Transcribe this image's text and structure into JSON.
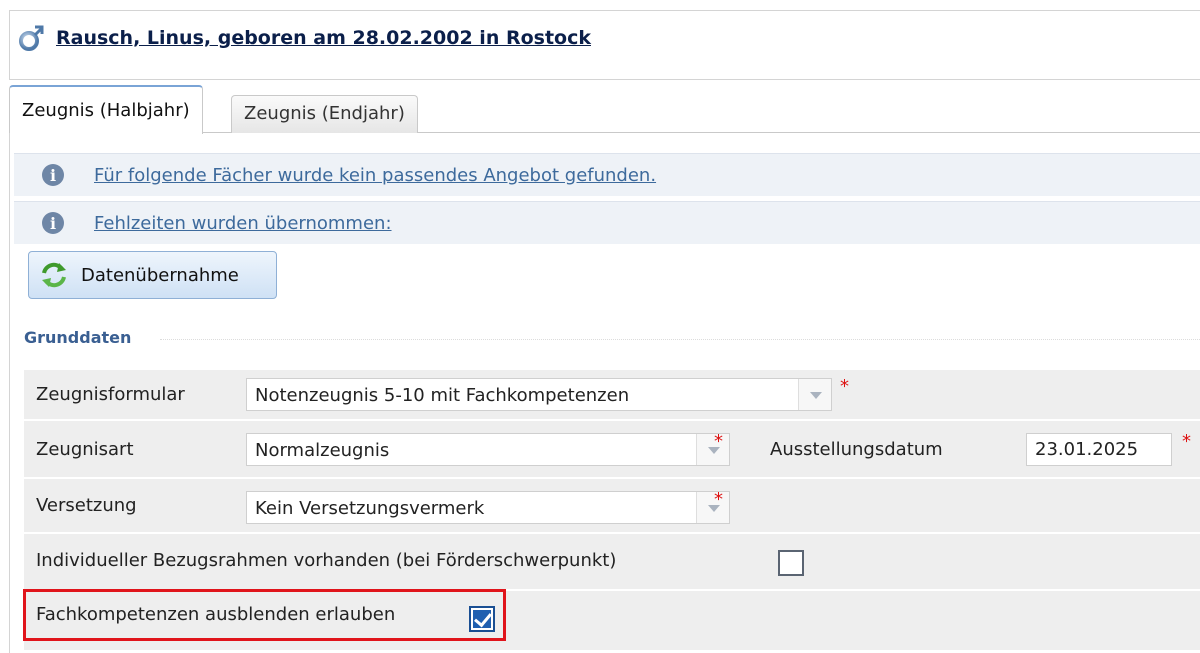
{
  "header": {
    "person_name": "Rausch, Linus, geboren am 28.02.2002 in Rostock",
    "person_icon": "male-person-icon"
  },
  "tabs": [
    {
      "label": "Zeugnis (Halbjahr)",
      "active": true
    },
    {
      "label": "Zeugnis (Endjahr)",
      "active": false
    }
  ],
  "messages": [
    {
      "icon": "info-icon",
      "text": "Für folgende Fächer wurde kein passendes Angebot gefunden."
    },
    {
      "icon": "info-icon",
      "text": "Fehlzeiten wurden übernommen:"
    }
  ],
  "sync_button": {
    "label": "Datenübernahme",
    "icon": "refresh-icon"
  },
  "section": {
    "title": "Grunddaten"
  },
  "form": {
    "zeugnisformular": {
      "label": "Zeugnisformular",
      "value": "Notenzeugnis 5-10 mit Fachkompetenzen",
      "required": "*"
    },
    "zeugnisart": {
      "label": "Zeugnisart",
      "value": "Normalzeugnis",
      "required": "*"
    },
    "ausstellungsdatum": {
      "label": "Ausstellungsdatum",
      "value": "23.01.2025",
      "required": "*"
    },
    "versetzung": {
      "label": "Versetzung",
      "value": "Kein Versetzungsvermerk",
      "required": "*"
    },
    "bezugsrahmen": {
      "label": "Individueller Bezugsrahmen vorhanden (bei Förderschwerpunkt)",
      "checked": false
    },
    "fachkompetenzen": {
      "label": "Fachkompetenzen ausblenden erlauben",
      "checked": true
    }
  },
  "colors": {
    "highlight": "#e0141b",
    "link": "#3d6a9c",
    "section_title": "#3a5f92"
  }
}
